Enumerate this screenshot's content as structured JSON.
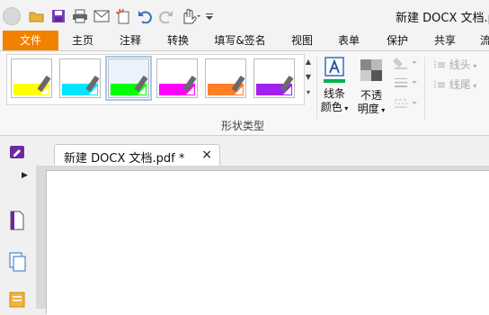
{
  "window": {
    "doc_title": "新建 DOCX 文档.pd"
  },
  "ribbon_tabs": [
    {
      "label": "文件",
      "active": true
    },
    {
      "label": "主页"
    },
    {
      "label": "注释"
    },
    {
      "label": "转换"
    },
    {
      "label": "填写&签名"
    },
    {
      "label": "视图"
    },
    {
      "label": "表单"
    },
    {
      "label": "保护"
    },
    {
      "label": "共享"
    },
    {
      "label": "流"
    }
  ],
  "shape_gallery": {
    "group_label": "形状类型",
    "swatches": [
      {
        "name": "yellow",
        "color": "#ffff00"
      },
      {
        "name": "cyan",
        "color": "#00e5ff"
      },
      {
        "name": "green",
        "color": "#00ff00",
        "selected": true
      },
      {
        "name": "magenta",
        "color": "#ff00ff"
      },
      {
        "name": "orange",
        "color": "#ff7f27"
      },
      {
        "name": "purple",
        "color": "#a020f0"
      }
    ]
  },
  "line_color": {
    "label_line1": "线条",
    "label_line2": "颜色",
    "accent": "#00b050"
  },
  "opacity": {
    "label_line1": "不透",
    "label_line2": "明度"
  },
  "line_ends": {
    "start_label": "线头",
    "end_label": "线尾"
  },
  "document_tab": {
    "label": "新建 DOCX 文档.pdf *",
    "close": "×"
  },
  "colors": {
    "brand_orange": "#f28100"
  }
}
